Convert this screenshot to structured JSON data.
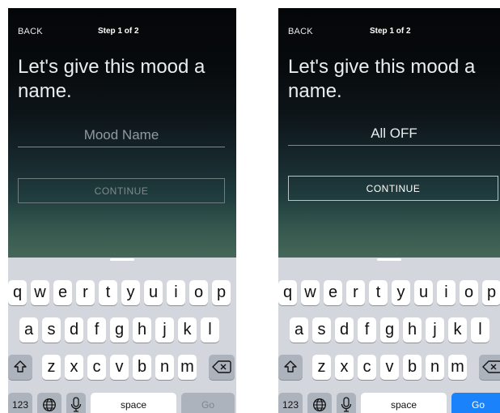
{
  "screens": [
    {
      "id": "left",
      "nav": {
        "back_label": "BACK",
        "step_label": "Step 1 of 2"
      },
      "headline": "Let's give this mood a name.",
      "mood_name": {
        "value": "",
        "placeholder": "Mood Name"
      },
      "continue_label": "CONTINUE",
      "continue_enabled": false,
      "keyboard": {
        "rows": [
          [
            "q",
            "w",
            "e",
            "r",
            "t",
            "y",
            "u",
            "i",
            "o",
            "p"
          ],
          [
            "a",
            "s",
            "d",
            "f",
            "g",
            "h",
            "j",
            "k",
            "l"
          ],
          [
            "z",
            "x",
            "c",
            "v",
            "b",
            "n",
            "m"
          ]
        ],
        "numbers_label": "123",
        "space_label": "space",
        "return_label": "Go",
        "return_color": "#adb3bc",
        "return_text_color": "#7f858c"
      }
    },
    {
      "id": "right",
      "nav": {
        "back_label": "BACK",
        "step_label": "Step 1 of 2"
      },
      "headline": "Let's give this mood a name.",
      "mood_name": {
        "value": "All OFF",
        "placeholder": "Mood Name"
      },
      "continue_label": "CONTINUE",
      "continue_enabled": true,
      "keyboard": {
        "rows": [
          [
            "q",
            "w",
            "e",
            "r",
            "t",
            "y",
            "u",
            "i",
            "o",
            "p"
          ],
          [
            "a",
            "s",
            "d",
            "f",
            "g",
            "h",
            "j",
            "k",
            "l"
          ],
          [
            "z",
            "x",
            "c",
            "v",
            "b",
            "n",
            "m"
          ]
        ],
        "numbers_label": "123",
        "space_label": "space",
        "return_label": "Go",
        "return_color": "#1a82fb",
        "return_text_color": "#ffffff"
      }
    }
  ],
  "icons": {
    "shift": "shift-icon",
    "delete": "backspace-icon",
    "globe": "globe-icon",
    "mic": "microphone-icon"
  }
}
